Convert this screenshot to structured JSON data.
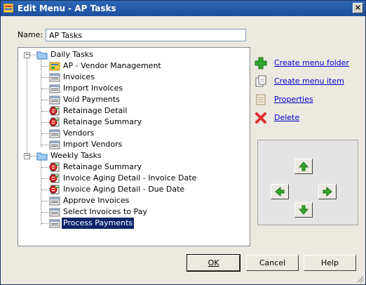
{
  "window": {
    "title": "Edit Menu - AP Tasks",
    "close_label": "×"
  },
  "name_label": "Name:",
  "name_value": "AP Tasks",
  "tree": {
    "groups": [
      {
        "label": "Daily Tasks",
        "items": [
          {
            "label": "AP - Vendor Management",
            "icon": "folder-app-icon"
          },
          {
            "label": "Invoices",
            "icon": "form-icon"
          },
          {
            "label": "Import Invoices",
            "icon": "form-icon"
          },
          {
            "label": "Void Payments",
            "icon": "form-icon"
          },
          {
            "label": "Retainage Detail",
            "icon": "report-icon"
          },
          {
            "label": "Retainage Summary",
            "icon": "report-icon"
          },
          {
            "label": "Vendors",
            "icon": "form-icon"
          },
          {
            "label": "Import Vendors",
            "icon": "form-icon"
          }
        ]
      },
      {
        "label": "Weekly Tasks",
        "items": [
          {
            "label": "Retainage Summary",
            "icon": "report-icon"
          },
          {
            "label": "Invoice Aging Detail - Invoice Date",
            "icon": "report-icon"
          },
          {
            "label": "Invoice Aging Detail - Due Date",
            "icon": "report-icon"
          },
          {
            "label": "Approve Invoices",
            "icon": "form-icon"
          },
          {
            "label": "Select Invoices to Pay",
            "icon": "form-icon"
          },
          {
            "label": "Process Payments",
            "icon": "form-icon"
          }
        ]
      }
    ],
    "selected": "Process Payments"
  },
  "actions": {
    "create_folder": "Create menu folder",
    "create_item": "Create menu item",
    "properties": "Properties",
    "delete": "Delete"
  },
  "buttons": {
    "ok": "OK",
    "cancel": "Cancel",
    "help": "Help"
  },
  "colors": {
    "accent_green": "#2ea82e",
    "selection": "#0a246a",
    "link": "#0000cc",
    "delete_red": "#e03030"
  }
}
